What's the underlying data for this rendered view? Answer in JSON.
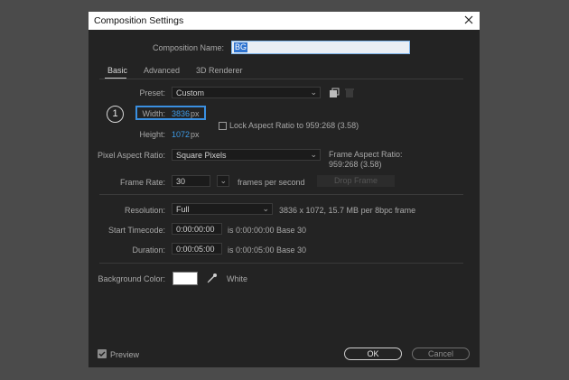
{
  "window": {
    "title": "Composition Settings"
  },
  "comp_name": {
    "label": "Composition Name:",
    "value": "BG"
  },
  "tabs": [
    {
      "label": "Basic"
    },
    {
      "label": "Advanced"
    },
    {
      "label": "3D Renderer"
    }
  ],
  "preset": {
    "label": "Preset:",
    "value": "Custom"
  },
  "step": "1",
  "width": {
    "label": "Width:",
    "value": "3836",
    "unit": "px"
  },
  "height": {
    "label": "Height:",
    "value": "1072",
    "unit": "px"
  },
  "lock_aspect": {
    "label": "Lock Aspect Ratio to 959:268 (3.58)",
    "checked": false
  },
  "pixel_aspect": {
    "label": "Pixel Aspect Ratio:",
    "value": "Square Pixels"
  },
  "frame_aspect": {
    "label": "Frame Aspect Ratio:",
    "value": "959:268 (3.58)"
  },
  "frame_rate": {
    "label": "Frame Rate:",
    "value": "30",
    "suffix": "frames per second",
    "drop_frame": "Drop Frame"
  },
  "resolution": {
    "label": "Resolution:",
    "value": "Full",
    "info": "3836 x 1072, 15.7 MB per 8bpc frame"
  },
  "start_timecode": {
    "label": "Start Timecode:",
    "value": "0:00:00:00",
    "info": "is 0:00:00:00  Base 30"
  },
  "duration": {
    "label": "Duration:",
    "value": "0:00:05:00",
    "info": "is 0:00:05:00  Base 30"
  },
  "background": {
    "label": "Background Color:",
    "color": "#ffffff",
    "name": "White"
  },
  "footer": {
    "preview_label": "Preview",
    "preview_checked": true,
    "ok": "OK",
    "cancel": "Cancel"
  },
  "colors": {
    "accent": "#3a8fe0",
    "dialog_bg": "#232323",
    "outer_bg": "#4b4b4b"
  }
}
